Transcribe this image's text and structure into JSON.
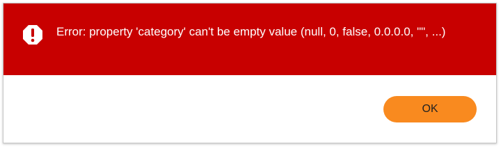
{
  "dialog": {
    "icon": "exclamation-octagon-icon",
    "message": "Error: property 'category' can't be empty value (null, 0, false, 0.0.0.0, \"\", ...)",
    "ok_label": "OK"
  },
  "colors": {
    "banner": "#c80000",
    "button": "#f98a1f",
    "message_text": "#ffffff"
  }
}
